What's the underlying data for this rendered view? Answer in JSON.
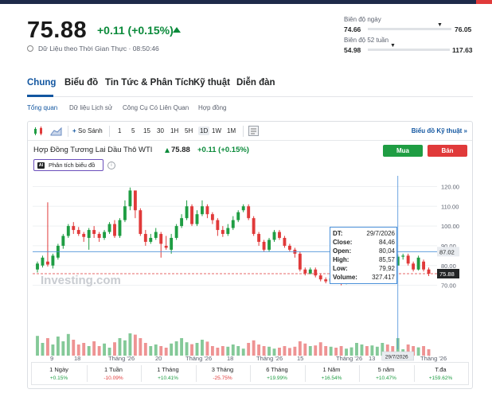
{
  "header": {
    "price": "75.88",
    "change": "+0.11 (+0.15%)",
    "realtime_note": "Dữ Liệu theo Thời Gian Thực · 08:50:46",
    "day_range": {
      "label": "Biên độ ngày",
      "low": "74.66",
      "high": "76.05",
      "position": 0.88
    },
    "week52_range": {
      "label": "Biên độ 52 tuần",
      "low": "54.98",
      "high": "117.63",
      "position": 0.33
    }
  },
  "tabs": [
    {
      "label": "Chung",
      "active": true
    },
    {
      "label": "Biểu đồ",
      "active": false
    },
    {
      "label": "Tin Tức & Phân Tích",
      "active": false
    },
    {
      "label": "Kỹ thuật",
      "active": false
    },
    {
      "label": "Diễn đàn",
      "active": false
    }
  ],
  "subtabs": [
    {
      "label": "Tổng quan",
      "active": true
    },
    {
      "label": "Dữ liệu Lịch sử",
      "active": false
    },
    {
      "label": "Công Cụ Có Liên Quan",
      "active": false
    },
    {
      "label": "Hợp đồng",
      "active": false
    }
  ],
  "toolbar": {
    "compare": "So Sánh",
    "intervals": [
      "1",
      "5",
      "15",
      "30",
      "1H",
      "5H",
      "1D",
      "1W",
      "1M"
    ],
    "active_interval": "1D",
    "technical_link": "Biểu đồ Kỹ thuật »"
  },
  "chart_header": {
    "title": "Hợp Đồng Tương Lai Dầu Thô WTI",
    "price": "75.88",
    "change": "+0.11 (+0.15%)",
    "ai_label": "Phân tích biểu đồ",
    "ai_badge": "AI",
    "info": "i",
    "buy": "Mua",
    "sell": "Bán"
  },
  "tooltip": {
    "rows": [
      {
        "k": "DT:",
        "v": "29/7/2026"
      },
      {
        "k": "Close:",
        "v": "84,46"
      },
      {
        "k": "Open:",
        "v": "80,04"
      },
      {
        "k": "High:",
        "v": "85,57"
      },
      {
        "k": "Low:",
        "v": "79,92"
      },
      {
        "k": "Volume:",
        "v": "327.417"
      }
    ]
  },
  "periods": [
    {
      "label": "1 Ngày",
      "value": "+0.15%",
      "positive": true
    },
    {
      "label": "1 Tuần",
      "value": "-10.09%",
      "positive": false
    },
    {
      "label": "1 Tháng",
      "value": "+10.41%",
      "positive": true
    },
    {
      "label": "3 Tháng",
      "value": "-25.75%",
      "positive": false
    },
    {
      "label": "6 Tháng",
      "value": "+19.99%",
      "positive": true
    },
    {
      "label": "1 Năm",
      "value": "+16.54%",
      "positive": true
    },
    {
      "label": "5 năm",
      "value": "+10.47%",
      "positive": true
    },
    {
      "label": "T.đa",
      "value": "+159.62%",
      "positive": true
    }
  ],
  "colors": {
    "up": "#1f9d43",
    "down": "#e03a3a",
    "accent": "#1256a0"
  },
  "chart_data": {
    "type": "candlestick",
    "y_ticks": [
      "120.00",
      "110.00",
      "100.00",
      "90.00",
      "80.00",
      "70.00"
    ],
    "y_range": [
      65,
      123
    ],
    "x_ticks": [
      "9",
      "18",
      "Tháng '26",
      "20",
      "Tháng '26",
      "18",
      "Tháng '26",
      "15",
      "Tháng '26",
      "13",
      "Tháng '26"
    ],
    "crosshair_price": "87.02",
    "crosshair_date": "29/7/2026",
    "current_price": "75.88",
    "watermark": "Investing.com",
    "candles": [
      {
        "o": 78.0,
        "c": 81.0,
        "h": 82.0,
        "l": 76.5,
        "v": 0.62
      },
      {
        "o": 80.0,
        "c": 84.0,
        "h": 85.0,
        "l": 79.0,
        "v": 0.4
      },
      {
        "o": 82.0,
        "c": 80.5,
        "h": 112.0,
        "l": 79.5,
        "v": 0.55
      },
      {
        "o": 80.0,
        "c": 85.0,
        "h": 86.0,
        "l": 78.5,
        "v": 0.35
      },
      {
        "o": 84.0,
        "c": 90.0,
        "h": 91.0,
        "l": 83.0,
        "v": 0.6
      },
      {
        "o": 90.0,
        "c": 95.0,
        "h": 96.0,
        "l": 88.5,
        "v": 0.45
      },
      {
        "o": 95.0,
        "c": 100.0,
        "h": 101.0,
        "l": 94.0,
        "v": 0.68
      },
      {
        "o": 100.0,
        "c": 98.0,
        "h": 102.0,
        "l": 96.0,
        "v": 0.5
      },
      {
        "o": 98.0,
        "c": 96.0,
        "h": 99.5,
        "l": 95.0,
        "v": 0.35
      },
      {
        "o": 96.0,
        "c": 94.5,
        "h": 97.0,
        "l": 92.0,
        "v": 0.4
      },
      {
        "o": 94.0,
        "c": 98.0,
        "h": 99.0,
        "l": 88.0,
        "v": 0.3
      },
      {
        "o": 98.0,
        "c": 96.0,
        "h": 100.0,
        "l": 94.0,
        "v": 0.45
      },
      {
        "o": 96.0,
        "c": 94.0,
        "h": 97.0,
        "l": 92.0,
        "v": 0.3
      },
      {
        "o": 94.0,
        "c": 97.0,
        "h": 98.0,
        "l": 93.0,
        "v": 0.38
      },
      {
        "o": 97.0,
        "c": 101.0,
        "h": 102.0,
        "l": 96.0,
        "v": 0.25
      },
      {
        "o": 101.0,
        "c": 95.0,
        "h": 103.0,
        "l": 94.0,
        "v": 0.42
      },
      {
        "o": 95.0,
        "c": 103.0,
        "h": 104.0,
        "l": 94.0,
        "v": 0.55
      },
      {
        "o": 103.0,
        "c": 110.0,
        "h": 113.0,
        "l": 102.0,
        "v": 0.48
      },
      {
        "o": 110.0,
        "c": 118.0,
        "h": 119.5,
        "l": 108.0,
        "v": 0.7
      },
      {
        "o": 118.0,
        "c": 108.0,
        "h": 116.0,
        "l": 104.0,
        "v": 0.66
      },
      {
        "o": 108.0,
        "c": 96.0,
        "h": 109.0,
        "l": 95.0,
        "v": 0.55
      },
      {
        "o": 96.0,
        "c": 92.0,
        "h": 98.0,
        "l": 90.0,
        "v": 0.4
      },
      {
        "o": 92.0,
        "c": 94.0,
        "h": 96.0,
        "l": 91.0,
        "v": 0.3
      },
      {
        "o": 94.0,
        "c": 97.0,
        "h": 99.0,
        "l": 93.0,
        "v": 0.35
      },
      {
        "o": 96.0,
        "c": 91.0,
        "h": 97.0,
        "l": 84.0,
        "v": 0.3
      },
      {
        "o": 90.0,
        "c": 89.0,
        "h": 95.0,
        "l": 88.0,
        "v": 0.25
      },
      {
        "o": 88.0,
        "c": 94.0,
        "h": 96.0,
        "l": 86.0,
        "v": 0.38
      },
      {
        "o": 94.0,
        "c": 100.0,
        "h": 101.0,
        "l": 93.0,
        "v": 0.45
      },
      {
        "o": 100.0,
        "c": 104.0,
        "h": 106.0,
        "l": 99.0,
        "v": 0.55
      },
      {
        "o": 104.0,
        "c": 110.0,
        "h": 113.0,
        "l": 103.0,
        "v": 0.42
      },
      {
        "o": 110.0,
        "c": 101.0,
        "h": 111.0,
        "l": 100.0,
        "v": 0.36
      },
      {
        "o": 101.0,
        "c": 106.0,
        "h": 108.0,
        "l": 100.0,
        "v": 0.4
      },
      {
        "o": 106.0,
        "c": 110.0,
        "h": 113.0,
        "l": 105.0,
        "v": 0.5
      },
      {
        "o": 110.0,
        "c": 106.0,
        "h": 111.0,
        "l": 104.0,
        "v": 0.44
      },
      {
        "o": 106.0,
        "c": 103.0,
        "h": 107.0,
        "l": 101.0,
        "v": 0.3
      },
      {
        "o": 103.0,
        "c": 98.0,
        "h": 104.0,
        "l": 95.0,
        "v": 0.25
      },
      {
        "o": 98.0,
        "c": 96.0,
        "h": 100.0,
        "l": 94.5,
        "v": 0.3
      },
      {
        "o": 96.0,
        "c": 99.0,
        "h": 101.0,
        "l": 95.0,
        "v": 0.28
      },
      {
        "o": 99.0,
        "c": 103.0,
        "h": 105.0,
        "l": 98.0,
        "v": 0.35
      },
      {
        "o": 103.0,
        "c": 107.0,
        "h": 108.0,
        "l": 102.0,
        "v": 0.3
      },
      {
        "o": 108.0,
        "c": 110.0,
        "h": 111.0,
        "l": 107.0,
        "v": 0.22
      },
      {
        "o": 110.0,
        "c": 104.0,
        "h": 111.0,
        "l": 103.0,
        "v": 0.4
      },
      {
        "o": 104.0,
        "c": 96.0,
        "h": 105.0,
        "l": 95.0,
        "v": 0.48
      },
      {
        "o": 96.0,
        "c": 92.0,
        "h": 97.0,
        "l": 90.0,
        "v": 0.35
      },
      {
        "o": 92.0,
        "c": 88.0,
        "h": 93.0,
        "l": 87.0,
        "v": 0.3
      },
      {
        "o": 88.0,
        "c": 93.0,
        "h": 94.0,
        "l": 87.0,
        "v": 0.28
      },
      {
        "o": 93.0,
        "c": 97.0,
        "h": 98.0,
        "l": 92.0,
        "v": 0.22
      },
      {
        "o": 97.0,
        "c": 94.0,
        "h": 98.0,
        "l": 93.0,
        "v": 0.25
      },
      {
        "o": 94.0,
        "c": 90.0,
        "h": 95.0,
        "l": 89.0,
        "v": 0.3
      },
      {
        "o": 90.0,
        "c": 88.0,
        "h": 91.0,
        "l": 87.0,
        "v": 0.24
      },
      {
        "o": 88.0,
        "c": 86.0,
        "h": 89.0,
        "l": 84.0,
        "v": 0.28
      },
      {
        "o": 86.0,
        "c": 78.0,
        "h": 87.0,
        "l": 77.0,
        "v": 0.45
      },
      {
        "o": 78.0,
        "c": 76.0,
        "h": 79.0,
        "l": 75.0,
        "v": 0.38
      },
      {
        "o": 76.0,
        "c": 78.0,
        "h": 79.0,
        "l": 75.5,
        "v": 0.3
      },
      {
        "o": 78.0,
        "c": 75.0,
        "h": 79.0,
        "l": 74.0,
        "v": 0.32
      },
      {
        "o": 75.0,
        "c": 73.0,
        "h": 76.0,
        "l": 72.0,
        "v": 0.42
      },
      {
        "o": 73.0,
        "c": 72.0,
        "h": 74.0,
        "l": 71.0,
        "v": 0.3
      },
      {
        "o": 72.0,
        "c": 73.5,
        "h": 74.0,
        "l": 71.0,
        "v": 0.28
      },
      {
        "o": 73.5,
        "c": 72.0,
        "h": 74.0,
        "l": 71.0,
        "v": 0.25
      },
      {
        "o": 72.0,
        "c": 71.0,
        "h": 73.0,
        "l": 70.0,
        "v": 0.3
      },
      {
        "o": 71.0,
        "c": 72.5,
        "h": 73.0,
        "l": 70.5,
        "v": 0.22
      },
      {
        "o": 72.5,
        "c": 74.0,
        "h": 75.0,
        "l": 71.5,
        "v": 0.26
      },
      {
        "o": 74.0,
        "c": 76.0,
        "h": 77.0,
        "l": 73.0,
        "v": 0.4
      },
      {
        "o": 76.0,
        "c": 79.0,
        "h": 80.0,
        "l": 75.0,
        "v": 0.35
      },
      {
        "o": 79.0,
        "c": 77.0,
        "h": 80.0,
        "l": 76.0,
        "v": 0.3
      },
      {
        "o": 77.0,
        "c": 80.0,
        "h": 81.0,
        "l": 76.0,
        "v": 0.32
      },
      {
        "o": 80.0,
        "c": 83.0,
        "h": 84.0,
        "l": 79.0,
        "v": 0.28
      },
      {
        "o": 83.0,
        "c": 86.0,
        "h": 87.0,
        "l": 82.0,
        "v": 0.4
      },
      {
        "o": 86.0,
        "c": 84.0,
        "h": 87.5,
        "l": 82.0,
        "v": 0.35
      },
      {
        "o": 84.0,
        "c": 82.0,
        "h": 85.0,
        "l": 80.0,
        "v": 0.3
      },
      {
        "o": 80.0,
        "c": 84.5,
        "h": 85.6,
        "l": 79.9,
        "v": 0.55
      },
      {
        "o": 84.5,
        "c": 85.0,
        "h": 86.0,
        "l": 83.0,
        "v": 0.2
      },
      {
        "o": 85.0,
        "c": 81.0,
        "h": 86.0,
        "l": 80.0,
        "v": 0.35
      },
      {
        "o": 81.0,
        "c": 78.0,
        "h": 82.0,
        "l": 77.0,
        "v": 0.3
      },
      {
        "o": 78.0,
        "c": 84.0,
        "h": 85.0,
        "l": 77.5,
        "v": 0.26
      },
      {
        "o": 82.0,
        "c": 78.0,
        "h": 83.0,
        "l": 77.0,
        "v": 0.3
      },
      {
        "o": 78.0,
        "c": 75.88,
        "h": 79.0,
        "l": 74.66,
        "v": 0.2
      }
    ]
  }
}
